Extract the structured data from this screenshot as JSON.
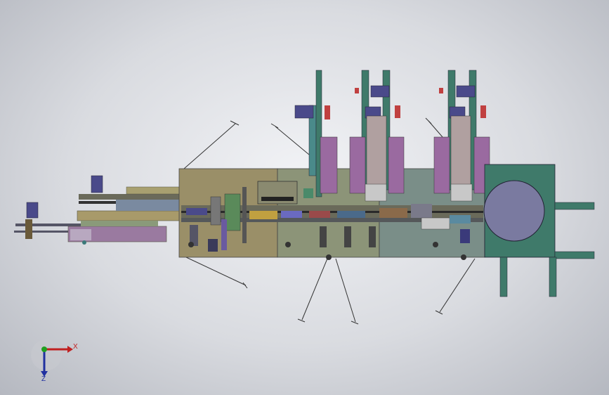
{
  "viewport": {
    "background_top": "#f2f3f6",
    "background_bottom": "#b5b8c0"
  },
  "model": {
    "frame_color": "#8a8a6a",
    "panel_color": "#7d8f8a",
    "motor_color": "#4a4a8a",
    "feeder_color": "#3f7a6a",
    "accent_color": "#c04040"
  },
  "triad": {
    "x_label": "X",
    "z_label": "Z",
    "x_color": "#c02020",
    "y_color": "#20a020",
    "z_color": "#2030a0"
  }
}
